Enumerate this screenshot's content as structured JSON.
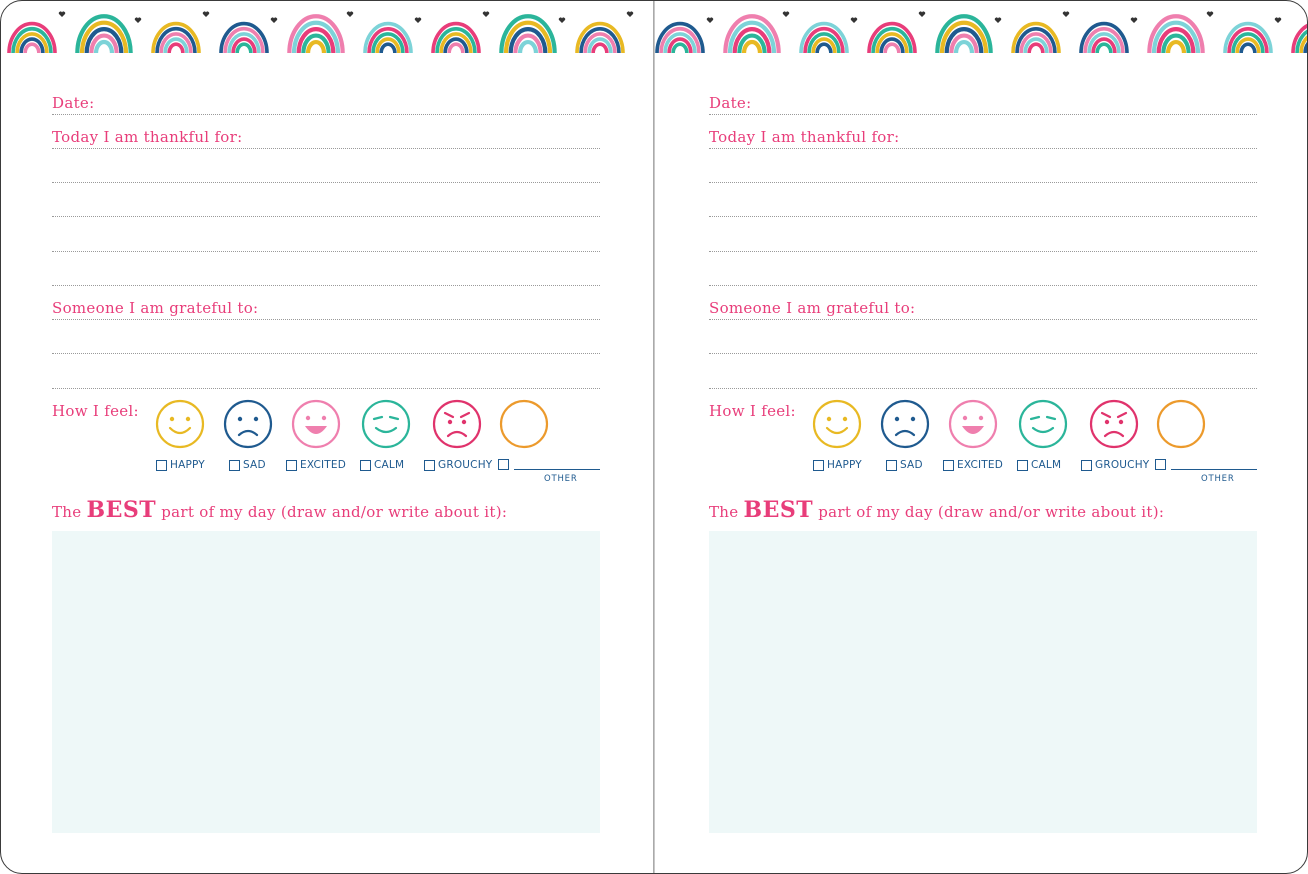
{
  "journal": {
    "date_label": "Date:",
    "thankful_label": "Today I am thankful for:",
    "grateful_label": "Someone I am grateful to:",
    "feel_label": "How I feel:",
    "best_prefix": "The",
    "best_emphasis": "BEST",
    "best_suffix": "part of my day (draw and/or write about it):",
    "moods": [
      "HAPPY",
      "SAD",
      "EXCITED",
      "CALM",
      "GROUCHY"
    ],
    "other_label": "OTHER"
  },
  "colors": {
    "label_pink": "#e83d7a",
    "happy": "#e8b923",
    "sad": "#1f5a8f",
    "excited": "#ef7fae",
    "calm": "#2bb59a",
    "grouchy": "#e0336c",
    "other": "#ec9a2c",
    "draw_area": "#eef8f8",
    "rainbow_palette": [
      "#e83d7a",
      "#2bb59a",
      "#e8b923",
      "#1f5a8f",
      "#ef7fae",
      "#7dd3d8"
    ]
  },
  "icons": {
    "border": "rainbow-icon",
    "heart": "heart-icon",
    "faces": [
      "happy-face-icon",
      "sad-face-icon",
      "excited-face-icon",
      "calm-face-icon",
      "grouchy-face-icon",
      "blank-face-icon"
    ]
  }
}
